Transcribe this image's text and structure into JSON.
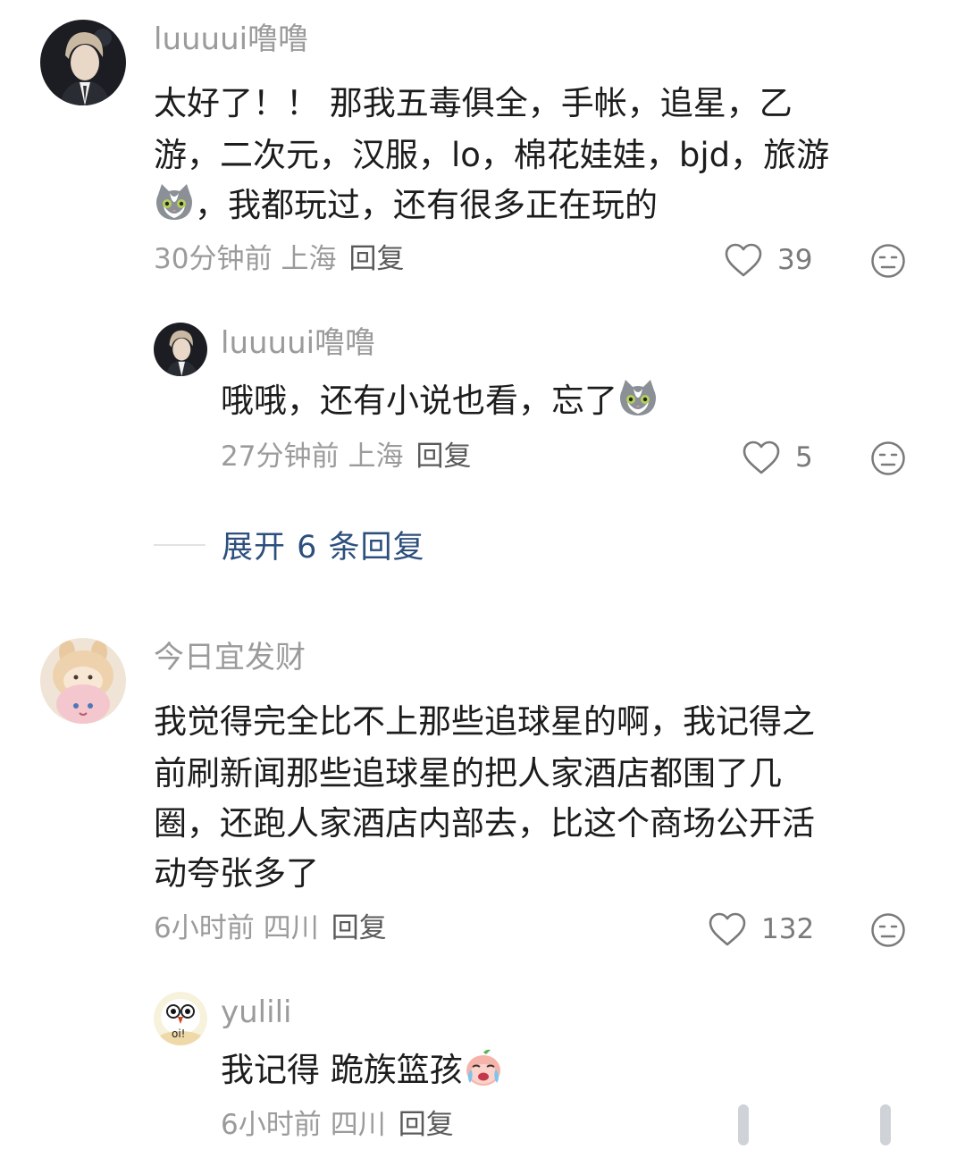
{
  "comments": [
    {
      "username": "luuuui噜噜",
      "lines": [
        "太好了！！ 那我五毒俱全，手帐，追星，乙",
        "游，二次元，汉服，lo，棉花娃娃，bjd，旅游",
        "，我都玩过，还有很多正在玩的"
      ],
      "emoji": "cat-sticker",
      "time": "30分钟前",
      "location": "上海",
      "reply_label": "回复",
      "likes": "39",
      "replies": [
        {
          "username": "luuuui噜噜",
          "text": "哦哦，还有小说也看，忘了",
          "emoji": "cat-sticker",
          "time": "27分钟前",
          "location": "上海",
          "reply_label": "回复",
          "likes": "5"
        }
      ],
      "expand_label": "展开 6 条回复"
    },
    {
      "username": "今日宜发财",
      "lines": [
        "我觉得完全比不上那些追球星的啊，我记得之",
        "前刷新闻那些追球星的把人家酒店都围了几",
        "圈，还跑人家酒店内部去，比这个商场公开活",
        "动夸张多了"
      ],
      "time": "6小时前",
      "location": "四川",
      "reply_label": "回复",
      "likes": "132",
      "replies": [
        {
          "username": "yulili",
          "avatar_text": "oi!",
          "text": "我记得 跪族篮孩",
          "emoji": "crying-peach-sticker",
          "time": "6小时前",
          "location": "四川",
          "reply_label": "回复"
        }
      ]
    }
  ],
  "icons": {
    "like": "heart-outline-icon",
    "dislike": "neutral-face-icon"
  },
  "colors": {
    "username": "#9b9b9b",
    "text": "#1c1c1c",
    "meta": "#9b9b9b",
    "expand": "#2d4f7d"
  }
}
